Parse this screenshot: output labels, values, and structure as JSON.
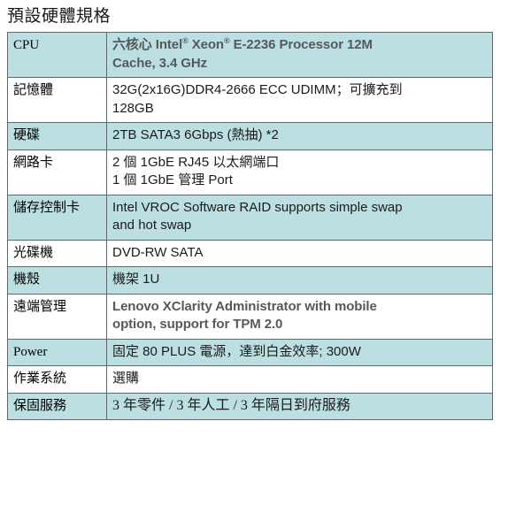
{
  "document": {
    "title": "預設硬體規格"
  },
  "spec_table": {
    "rows": [
      {
        "label": "CPU",
        "label_style": "serif",
        "shaded": true,
        "value_style": "bold",
        "lines": [
          "六核心 Intel® Xeon® E-2236 Processor 12M",
          "Cache, 3.4 GHz"
        ],
        "value_text": "六核心 Intel® Xeon® E-2236 Processor 12M Cache, 3.4 GHz"
      },
      {
        "label": "記憶體",
        "label_style": "sans",
        "shaded": false,
        "value_style": "normal",
        "lines": [
          "32G(2x16G)DDR4-2666 ECC UDIMM；可擴充到",
          "128GB"
        ],
        "value_text": "32G(2x16G)DDR4-2666 ECC UDIMM；可擴充到 128GB"
      },
      {
        "label": "硬碟",
        "label_style": "sans",
        "shaded": true,
        "value_style": "normal",
        "lines": [
          "2TB SATA3 6Gbps (熱抽) *2"
        ],
        "value_text": "2TB SATA3 6Gbps (熱抽) *2"
      },
      {
        "label": "網路卡",
        "label_style": "sans",
        "shaded": false,
        "value_style": "normal",
        "lines": [
          "2 個 1GbE RJ45 以太網端口",
          "1 個 1GbE 管理 Port"
        ],
        "value_text": "2 個 1GbE RJ45 以太網端口 / 1 個 1GbE 管理 Port"
      },
      {
        "label": "儲存控制卡",
        "label_style": "sans",
        "shaded": true,
        "value_style": "normal",
        "lines": [
          "Intel VROC Software RAID supports simple swap",
          "and hot swap"
        ],
        "value_text": "Intel VROC Software RAID supports simple swap and hot swap"
      },
      {
        "label": "光碟機",
        "label_style": "sans",
        "shaded": false,
        "value_style": "normal",
        "lines": [
          "DVD-RW SATA"
        ],
        "value_text": "DVD-RW SATA"
      },
      {
        "label": "機殼",
        "label_style": "sans",
        "shaded": true,
        "value_style": "normal",
        "lines": [
          "機架 1U"
        ],
        "value_text": "機架 1U"
      },
      {
        "label": "遠端管理",
        "label_style": "sans",
        "shaded": false,
        "value_style": "bold",
        "lines": [
          "Lenovo XClarity Administrator with mobile",
          "option, support for TPM 2.0"
        ],
        "value_text": "Lenovo XClarity Administrator with mobile option, support for TPM 2.0"
      },
      {
        "label": "Power",
        "label_style": "serif",
        "shaded": true,
        "value_style": "normal",
        "lines": [
          "固定 80 PLUS 電源，達到白金效率; 300W"
        ],
        "value_text": "固定 80 PLUS 電源，達到白金效率; 300W"
      },
      {
        "label": "作業系統",
        "label_style": "sans",
        "shaded": false,
        "value_style": "normal",
        "lines": [
          "選購"
        ],
        "value_text": "選購"
      },
      {
        "label": "保固服務",
        "label_style": "sans",
        "shaded": true,
        "value_style": "serif",
        "lines": [
          "3 年零件 / 3 年人工 / 3 年隔日到府服務"
        ],
        "value_text": "3 年零件 / 3 年人工 / 3 年隔日到府服務"
      }
    ]
  },
  "colors": {
    "shaded_row_background": "#bcdfe1",
    "plain_row_background": "#ffffff",
    "border": "#5b6a70",
    "table_outer_border": "#3d4a4f",
    "bold_value_text": "#55595b",
    "normal_text": "#1b1b1b"
  }
}
